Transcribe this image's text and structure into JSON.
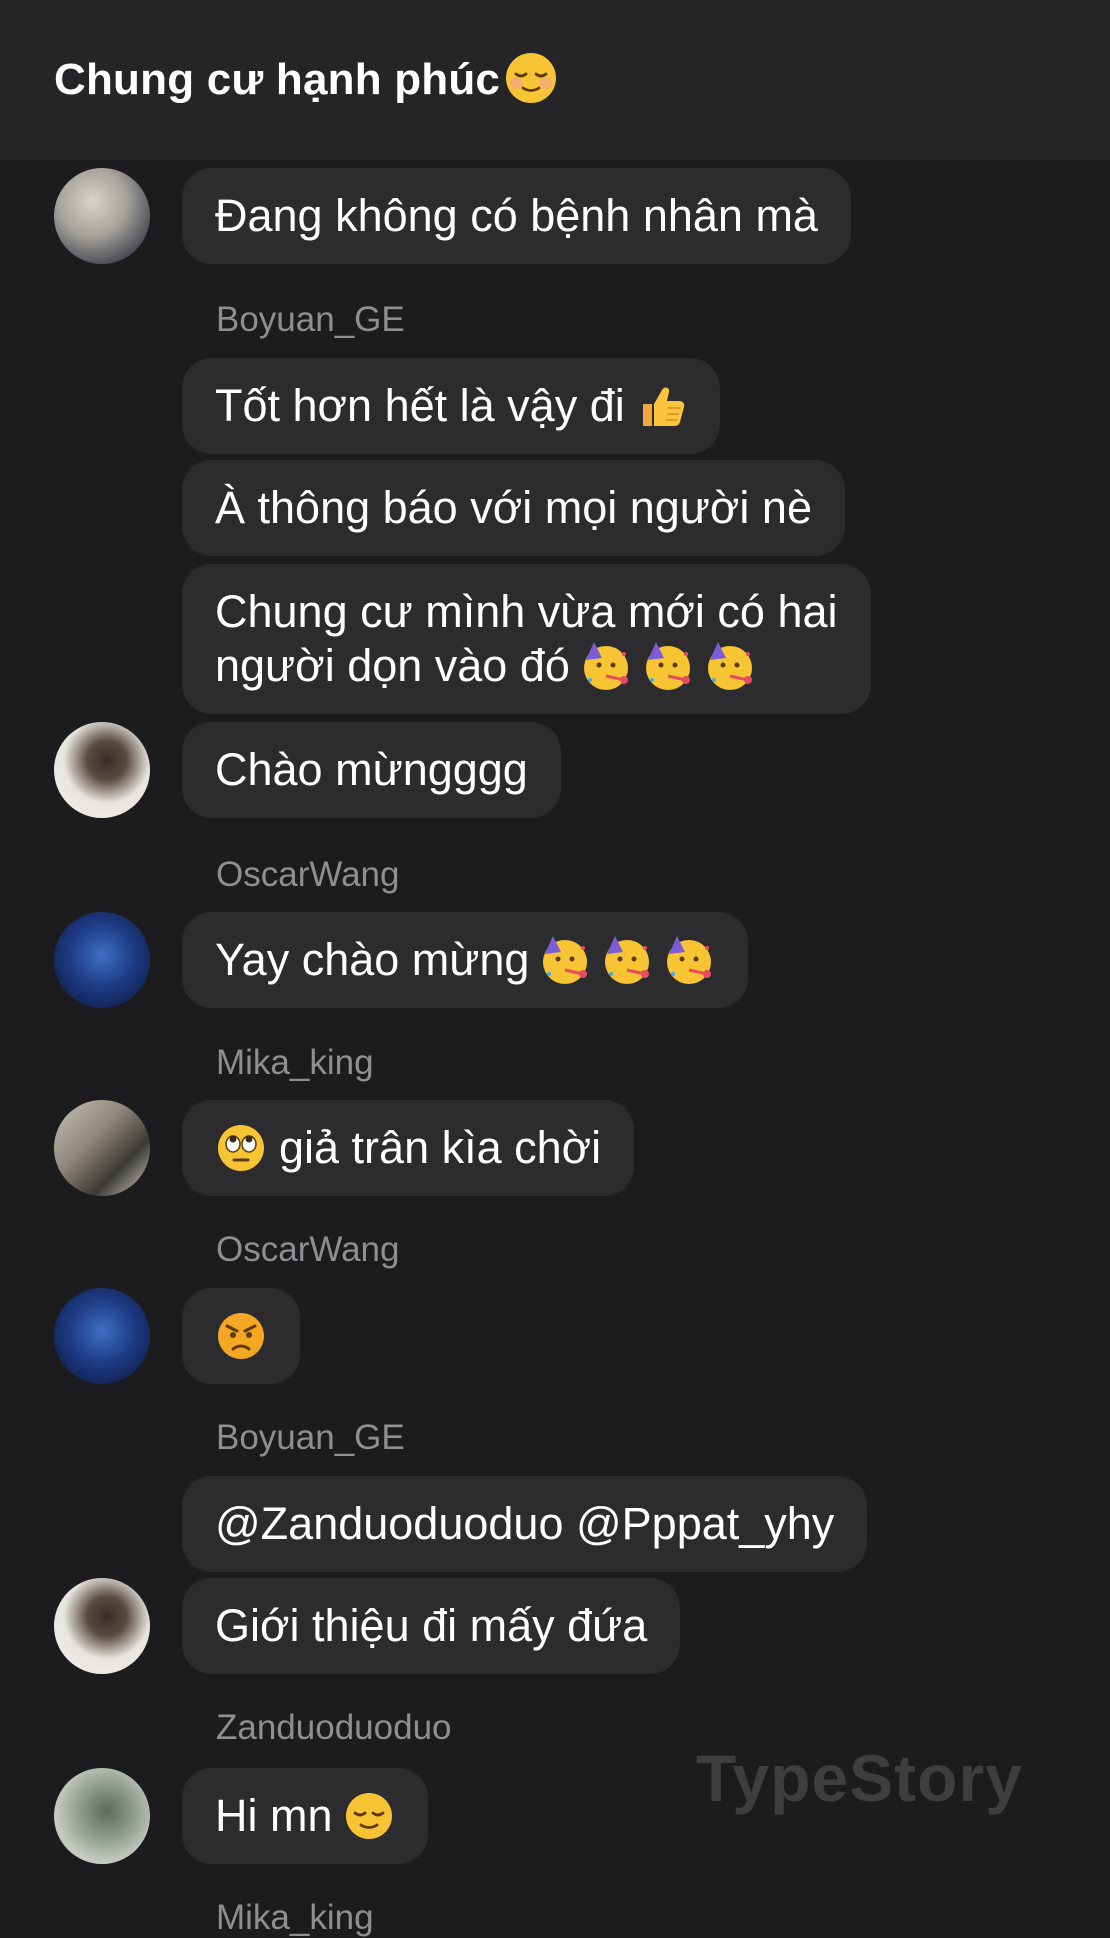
{
  "header": {
    "title": "Chung cư hạnh phúc",
    "title_emoji": "relieved-face-emoji"
  },
  "messages": [
    {
      "text": "Đang không có bệnh nhân mà"
    },
    {
      "sender": "Boyuan_GE"
    },
    {
      "text": "Tốt hơn hết là vậy đi",
      "emoji": "thumbs-up-emoji"
    },
    {
      "text": "À thông báo với mọi người nè"
    },
    {
      "line1": "Chung cư mình vừa mới có hai",
      "line2": "người dọn vào đó",
      "emoji": "partying-face-emoji x3"
    },
    {
      "text": "Chào mừngggg"
    },
    {
      "sender": "OscarWang"
    },
    {
      "text": "Yay chào mừng",
      "emoji": "partying-face-emoji x3"
    },
    {
      "sender": "Mika_king"
    },
    {
      "text": "giả trân kìa chời",
      "emoji": "eye-roll-emoji"
    },
    {
      "sender": "OscarWang"
    },
    {
      "emoji": "angry-face-emoji"
    },
    {
      "sender": "Boyuan_GE"
    },
    {
      "text": "@Zanduoduoduo @Pppat_yhy"
    },
    {
      "text": "Giới thiệu đi mấy đứa"
    },
    {
      "sender": "Zanduoduoduo"
    },
    {
      "text": "Hi mn",
      "emoji": "relieved-face-emoji"
    },
    {
      "sender": "Mika_king"
    }
  ],
  "watermark": "TypeStory",
  "colors": {
    "background": "#1c1c1e",
    "header": "#252527",
    "bubble": "#2c2c2e",
    "sender": "#8e8e93",
    "watermark": "#3e3e40"
  }
}
